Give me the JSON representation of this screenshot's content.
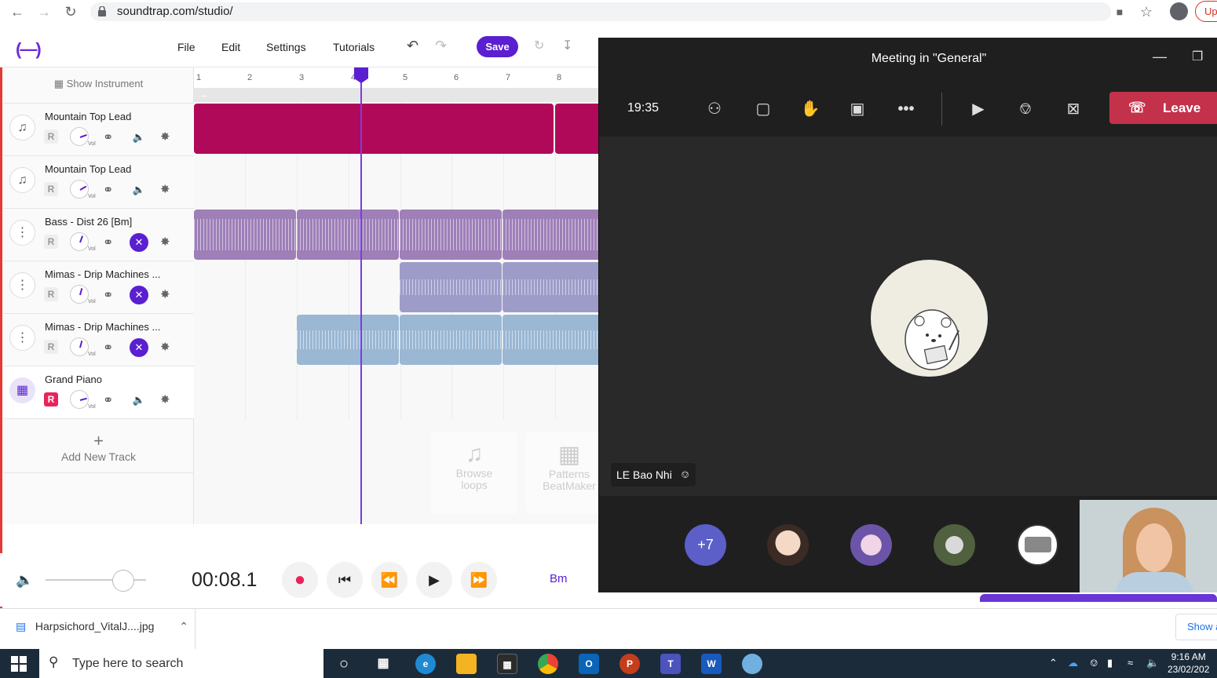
{
  "browser": {
    "url": "soundtrap.com/studio/",
    "update_label": "Up"
  },
  "studio": {
    "logo": "(—)",
    "menu": [
      "File",
      "Edit",
      "Settings",
      "Tutorials"
    ],
    "save_label": "Save",
    "show_instrument": "Show Instrument",
    "tracks": [
      {
        "name": "Mountain Top Lead",
        "r": "R",
        "vol": "Vol"
      },
      {
        "name": "Mountain Top Lead",
        "r": "R",
        "vol": "Vol"
      },
      {
        "name": "Bass - Dist 26 [Bm]",
        "r": "R",
        "vol": "Vol"
      },
      {
        "name": "Mimas - Drip Machines ...",
        "r": "R",
        "vol": "Vol"
      },
      {
        "name": "Mimas - Drip Machines ...",
        "r": "R",
        "vol": "Vol"
      },
      {
        "name": "Grand Piano",
        "r": "R",
        "vol": "Vol"
      }
    ],
    "add_track": "Add New Track",
    "ruler": [
      "1",
      "2",
      "3",
      "4",
      "5",
      "6",
      "7",
      "8"
    ],
    "cards": {
      "browse_loops": "Browse loops",
      "patterns": "Patterns BeatMaker"
    },
    "transport_time": "00:08.1",
    "key": "Bm",
    "colors": {
      "accent": "#5a1fd1",
      "lead": "#b0095a",
      "bass": "#9e7fb8",
      "drip1": "#9d9cc9",
      "drip2": "#9ab7d3",
      "record": "#e8245b"
    }
  },
  "download": {
    "file": "Harpsichord_VitalJ....jpg",
    "show_all": "Show a"
  },
  "teams": {
    "title": "Meeting in \"General\"",
    "time": "19:35",
    "leave_label": "Leave",
    "participant_name": "LE Bao Nhi",
    "more_count": "+7"
  },
  "taskbar": {
    "search_placeholder": "Type here to search",
    "time": "9:16 AM",
    "date": "23/02/202"
  }
}
